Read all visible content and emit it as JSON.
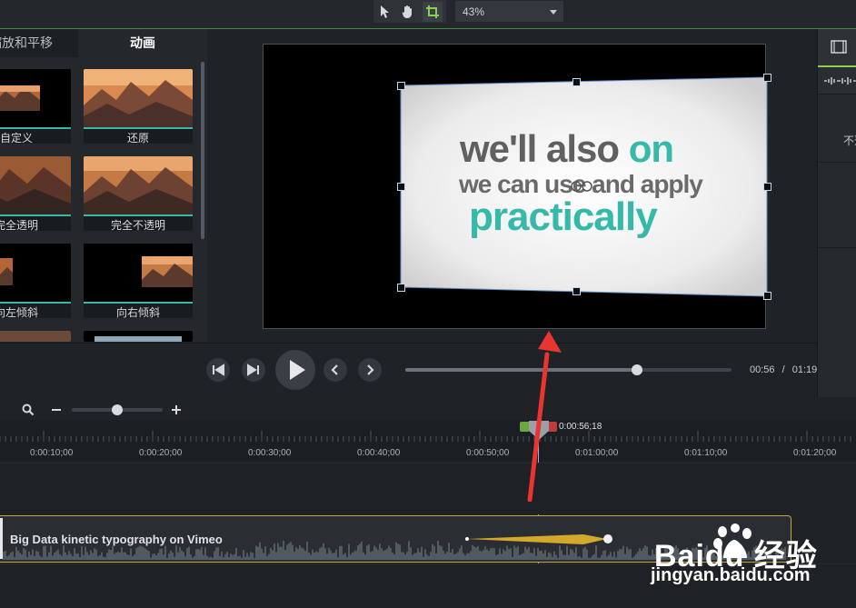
{
  "toolbar": {
    "tools": [
      "select-pointer",
      "pan-hand",
      "crop"
    ],
    "zoom_level": "43%"
  },
  "left_panel": {
    "tabs": [
      "缩放和平移",
      "动画"
    ],
    "presets": [
      {
        "label": "自定义"
      },
      {
        "label": "还原"
      },
      {
        "label": "完全透明"
      },
      {
        "label": "完全不透明"
      },
      {
        "label": "向左倾斜"
      },
      {
        "label": "向右倾斜"
      }
    ]
  },
  "preview": {
    "line1_a": "we'll also",
    "line1_b": "on",
    "line2": "we can use and apply",
    "line3": "practically"
  },
  "playback": {
    "current_time": "00:56",
    "separator": "/",
    "total_time": "01:19",
    "progress": 0.709
  },
  "timeline": {
    "playhead_time": "0:00:56;18",
    "ticks": [
      "0:00:10;00",
      "0:00:20;00",
      "0:00:30;00",
      "0:00:40;00",
      "0:00:50;00",
      "0:01:00;00",
      "0:01:10;00",
      "0:01:20;00"
    ],
    "clip_name": "Big Data kinetic typography on Vimeo"
  },
  "right_panel": {
    "partial_label": "不透"
  },
  "watermark": {
    "brand": "Baidu 经验",
    "url": "jingyan.baidu.com"
  },
  "colors": {
    "accent_teal": "#35b9a9",
    "annotation_red": "#e8352f",
    "clip_border": "#c5a53c",
    "animation_arrow": "#d4a82a"
  }
}
